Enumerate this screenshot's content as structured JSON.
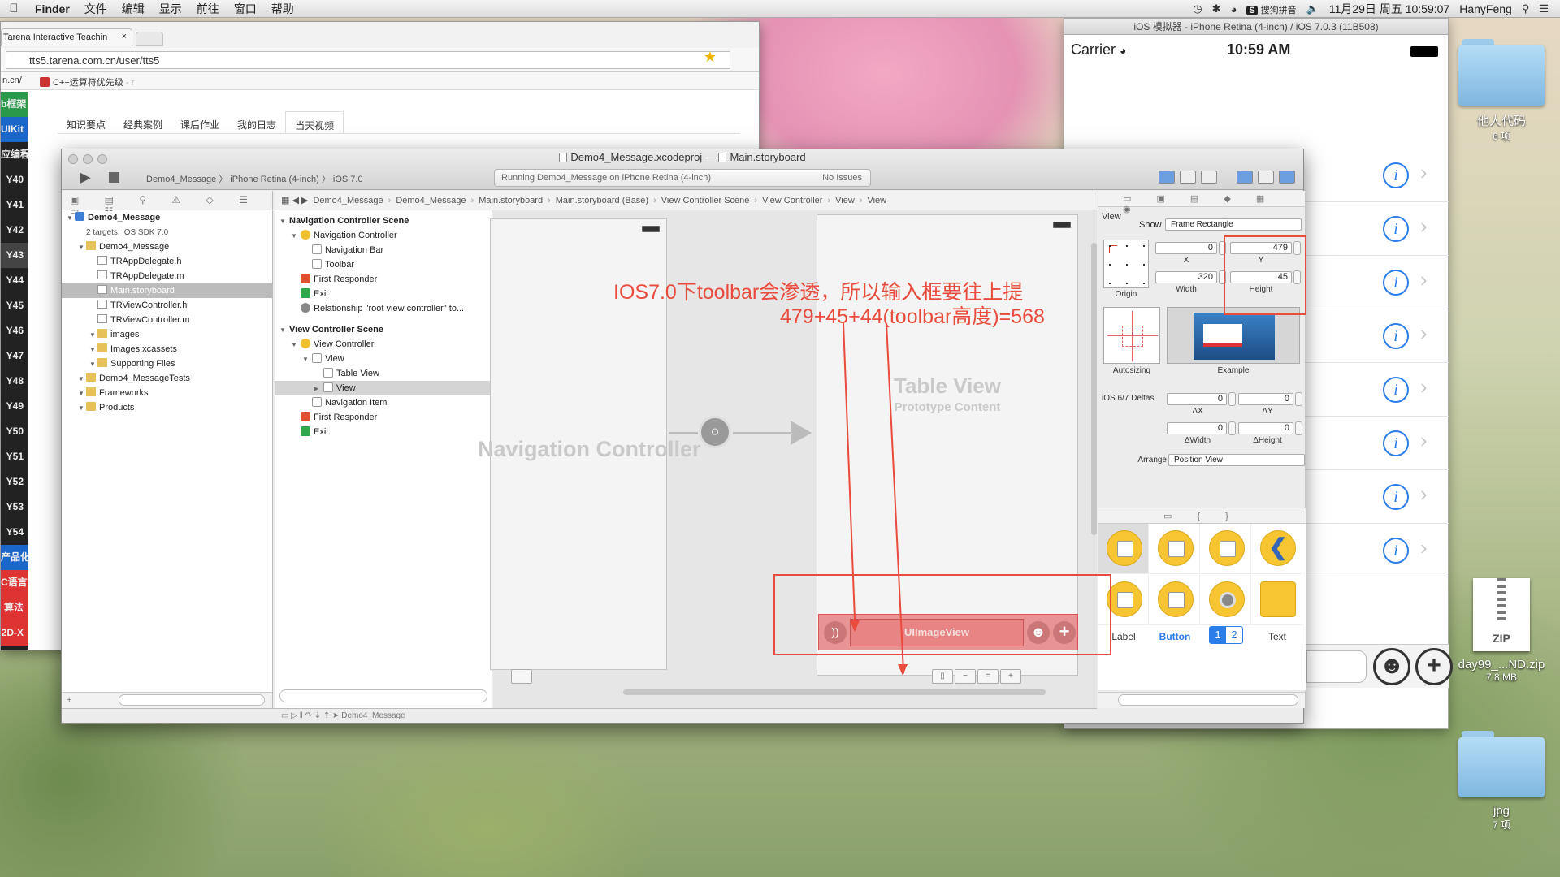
{
  "menubar": {
    "apple": "",
    "app": "Finder",
    "items": [
      "文件",
      "编辑",
      "显示",
      "前往",
      "窗口",
      "帮助"
    ],
    "input_method": "搜狗拼音",
    "datetime": "11月29日 周五  10:59:07",
    "user": "HanyFeng"
  },
  "browser": {
    "tab_title": "Tarena Interactive Teachin",
    "tab_close": "×",
    "url": "tts5.tarena.com.cn/user/tts5",
    "bookmark_prefix": "n.cn/",
    "bookmark": "C++运算符优先级",
    "bookmark_suffix": "- r",
    "left_nav": [
      "b框架",
      "UIKit",
      "应编程",
      "Y40",
      "Y41",
      "Y42",
      "Y43",
      "Y44",
      "Y45",
      "Y46",
      "Y47",
      "Y48",
      "Y49",
      "Y50",
      "Y51",
      "Y52",
      "Y53",
      "Y54",
      "产品化",
      "C语言",
      "算法",
      "2D-X"
    ],
    "tabs": [
      "知识要点",
      "经典案例",
      "课后作业",
      "我的日志",
      "当天视频"
    ],
    "active_tab": 4
  },
  "simulator": {
    "title": "iOS 模拟器 - iPhone Retina (4-inch) / iOS 7.0.3 (11B508)",
    "carrier": "Carrier",
    "time": "10:59 AM",
    "row_count_icons": [
      "i",
      "i",
      "i",
      "i",
      "i",
      "i",
      "i",
      "i"
    ],
    "chevron": "›",
    "smile": "☻",
    "plus": "+"
  },
  "desktop": {
    "folder1": {
      "name": "他人代码",
      "sub": "6 项"
    },
    "zip": {
      "name": "day99_...ND.zip",
      "sub": "7.8 MB",
      "label": "ZIP"
    },
    "folder2": {
      "name": "jpg",
      "sub": "7 项"
    }
  },
  "xcode": {
    "title_file": "Demo4_Message.xcodeproj",
    "title_sep": "—",
    "title_storyboard": "Main.storyboard",
    "scheme": "Demo4_Message  〉 iPhone Retina (4-inch)  〉 iOS 7.0",
    "activity": "Running Demo4_Message on iPhone Retina (4-inch)",
    "issues": "No Issues",
    "jump_bar": [
      "Demo4_Message",
      "Demo4_Message",
      "Main.storyboard",
      "Main.storyboard (Base)",
      "View Controller Scene",
      "View Controller",
      "View",
      "View"
    ],
    "navigator": [
      {
        "text": "Demo4_Message",
        "indent": 0,
        "icon": "proj",
        "bold": true
      },
      {
        "text": "2 targets, iOS SDK 7.0",
        "indent": 1,
        "icon": "",
        "bold": false
      },
      {
        "text": "Demo4_Message",
        "indent": 1,
        "icon": "folder-y",
        "bold": false
      },
      {
        "text": "TRAppDelegate.h",
        "indent": 2,
        "icon": "file-h",
        "bold": false
      },
      {
        "text": "TRAppDelegate.m",
        "indent": 2,
        "icon": "file-h",
        "bold": false
      },
      {
        "text": "Main.storyboard",
        "indent": 2,
        "icon": "sb",
        "bold": false,
        "selected": true
      },
      {
        "text": "TRViewController.h",
        "indent": 2,
        "icon": "file-h",
        "bold": false
      },
      {
        "text": "TRViewController.m",
        "indent": 2,
        "icon": "file-h",
        "bold": false
      },
      {
        "text": "images",
        "indent": 2,
        "icon": "folder-y",
        "bold": false
      },
      {
        "text": "Images.xcassets",
        "indent": 2,
        "icon": "folder-y",
        "bold": false
      },
      {
        "text": "Supporting Files",
        "indent": 2,
        "icon": "folder-y",
        "bold": false
      },
      {
        "text": "Demo4_MessageTests",
        "indent": 1,
        "icon": "folder-y",
        "bold": false
      },
      {
        "text": "Frameworks",
        "indent": 1,
        "icon": "folder-y",
        "bold": false
      },
      {
        "text": "Products",
        "indent": 1,
        "icon": "folder-y",
        "bold": false
      }
    ],
    "outline": [
      {
        "text": "Navigation Controller Scene",
        "indent": 0,
        "icon": "",
        "bold": true
      },
      {
        "text": "Navigation Controller",
        "indent": 1,
        "icon": "nc",
        "bold": false
      },
      {
        "text": "Navigation Bar",
        "indent": 2,
        "icon": "vw",
        "bold": false
      },
      {
        "text": "Toolbar",
        "indent": 2,
        "icon": "vw",
        "bold": false
      },
      {
        "text": "First Responder",
        "indent": 1,
        "icon": "fr",
        "bold": false
      },
      {
        "text": "Exit",
        "indent": 1,
        "icon": "ex",
        "bold": false
      },
      {
        "text": "Relationship \"root view controller\" to...",
        "indent": 1,
        "icon": "rel",
        "bold": false
      },
      {
        "text": "View Controller Scene",
        "indent": 0,
        "icon": "",
        "bold": true
      },
      {
        "text": "View Controller",
        "indent": 1,
        "icon": "nc",
        "bold": false
      },
      {
        "text": "View",
        "indent": 2,
        "icon": "vw",
        "bold": false
      },
      {
        "text": "Table View",
        "indent": 3,
        "icon": "vw",
        "bold": false
      },
      {
        "text": "View",
        "indent": 3,
        "icon": "vw",
        "bold": false,
        "selected": true
      },
      {
        "text": "Navigation Item",
        "indent": 2,
        "icon": "vw",
        "bold": false
      },
      {
        "text": "First Responder",
        "indent": 1,
        "icon": "fr",
        "bold": false
      },
      {
        "text": "Exit",
        "indent": 1,
        "icon": "ex",
        "bold": false
      }
    ],
    "canvas": {
      "nav_label": "Navigation Controller",
      "table_label": "Table View",
      "proto_label": "Prototype Content",
      "image_view": "UIImageView",
      "annotation1": "IOS7.0下toolbar会渗透，所以输入框要往上提",
      "annotation2": "479+45+44(toolbar高度)=568"
    },
    "inspector": {
      "section": "View",
      "show_label": "Show",
      "show_value": "Frame Rectangle",
      "x": "0",
      "y": "479",
      "width": "320",
      "height": "45",
      "x_label": "X",
      "y_label": "Y",
      "w_label": "Width",
      "h_label": "Height",
      "origin_label": "Origin",
      "autosizing_label": "Autosizing",
      "example_label": "Example",
      "deltas_label": "iOS 6/7 Deltas",
      "dx": "0",
      "dy": "0",
      "dw": "0",
      "dh": "0",
      "dx_label": "ΔX",
      "dy_label": "ΔY",
      "dw_label": "ΔWidth",
      "dh_label": "ΔHeight",
      "arrange_label": "Arrange",
      "arrange_value": "Position View",
      "lib_labels": [
        "Label",
        "Button",
        "Text"
      ],
      "seg1": "1",
      "seg2": "2"
    },
    "debug_target": "Demo4_Message"
  }
}
